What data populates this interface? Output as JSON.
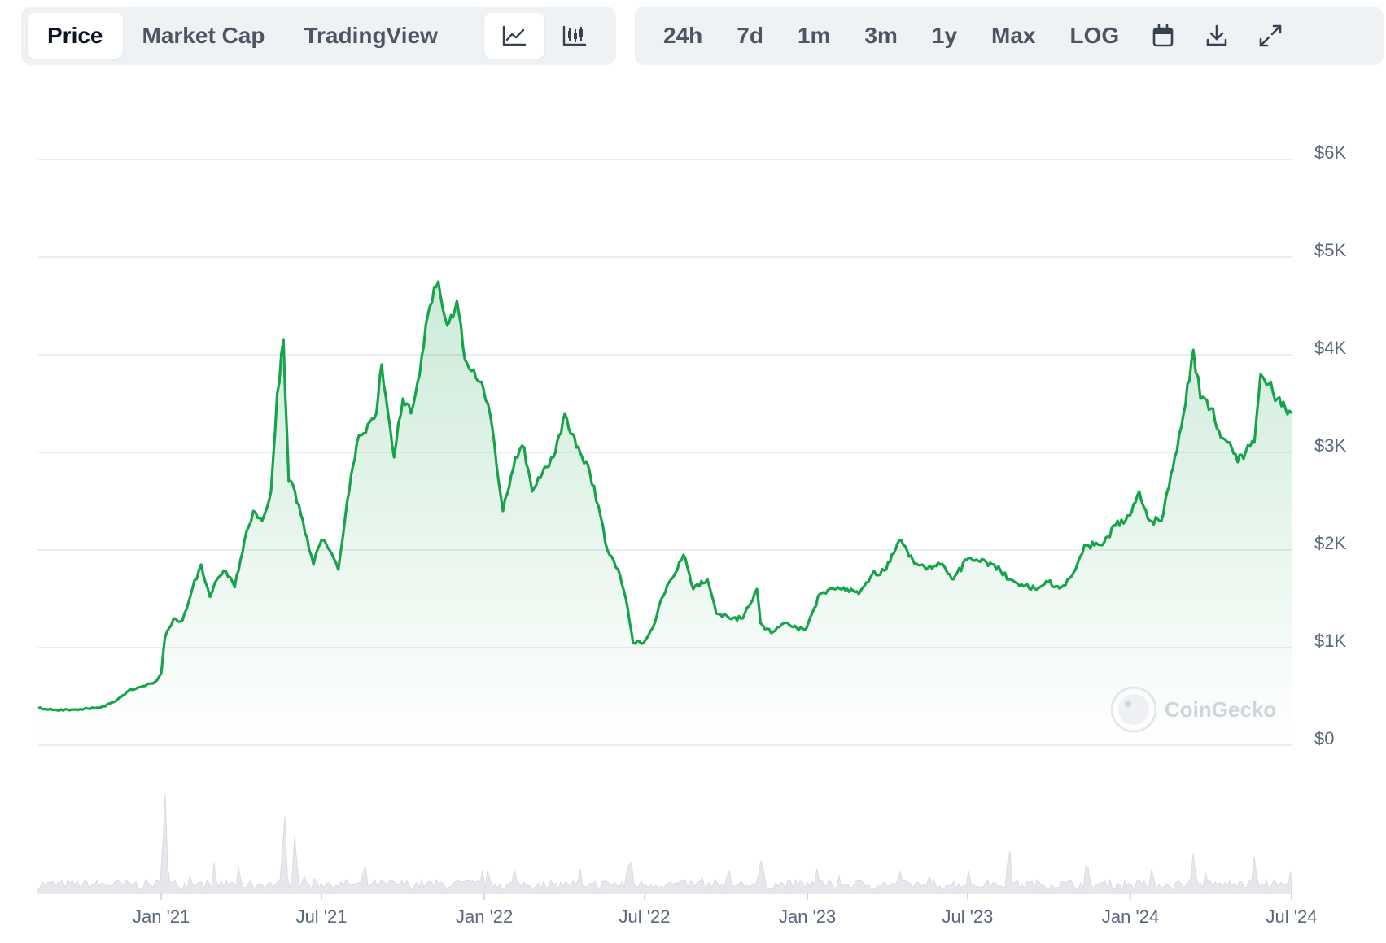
{
  "toolbar": {
    "chart_tabs": [
      {
        "label": "Price",
        "active": true
      },
      {
        "label": "Market Cap",
        "active": false
      },
      {
        "label": "TradingView",
        "active": false
      }
    ],
    "chart_style_icons": [
      "line-chart-icon",
      "candlestick-chart-icon"
    ],
    "ranges": [
      "24h",
      "7d",
      "1m",
      "3m",
      "1y",
      "Max",
      "LOG"
    ],
    "action_icons": [
      "calendar-icon",
      "download-icon",
      "fullscreen-icon"
    ]
  },
  "watermark": {
    "brand": "CoinGecko"
  },
  "colors": {
    "line": "#16a34a",
    "fill_top": "#16a34a",
    "grid": "#e5e7eb",
    "volume": "#e5e7eb",
    "toolbar_bg": "#eff2f5"
  },
  "chart_data": {
    "type": "area",
    "ylim": [
      0,
      6000
    ],
    "y_ticks": [
      {
        "value": 0,
        "label": "$0"
      },
      {
        "value": 1000,
        "label": "$1K"
      },
      {
        "value": 2000,
        "label": "$2K"
      },
      {
        "value": 3000,
        "label": "$3K"
      },
      {
        "value": 4000,
        "label": "$4K"
      },
      {
        "value": 5000,
        "label": "$5K"
      },
      {
        "value": 6000,
        "label": "$6K"
      }
    ],
    "x_range": [
      "2020-08-15",
      "2024-07-01"
    ],
    "x_ticks": [
      {
        "date": "2021-01-01",
        "label": "Jan '21"
      },
      {
        "date": "2021-07-01",
        "label": "Jul '21"
      },
      {
        "date": "2022-01-01",
        "label": "Jan '22"
      },
      {
        "date": "2022-07-01",
        "label": "Jul '22"
      },
      {
        "date": "2023-01-01",
        "label": "Jan '23"
      },
      {
        "date": "2023-07-01",
        "label": "Jul '23"
      },
      {
        "date": "2024-01-01",
        "label": "Jan '24"
      },
      {
        "date": "2024-07-01",
        "label": "Jul '24"
      }
    ],
    "grid": true,
    "series": [
      {
        "x": [
          "2020-08-15",
          "2020-09-05",
          "2020-10-01",
          "2020-10-25",
          "2020-11-10",
          "2020-11-25",
          "2020-12-10",
          "2020-12-25",
          "2021-01-01",
          "2021-01-05",
          "2021-01-15",
          "2021-01-25",
          "2021-02-05",
          "2021-02-15",
          "2021-02-25",
          "2021-03-05",
          "2021-03-15",
          "2021-03-25",
          "2021-04-05",
          "2021-04-15",
          "2021-04-25",
          "2021-05-05",
          "2021-05-12",
          "2021-05-19",
          "2021-05-25",
          "2021-06-01",
          "2021-06-10",
          "2021-06-22",
          "2021-07-01",
          "2021-07-10",
          "2021-07-20",
          "2021-07-30",
          "2021-08-10",
          "2021-08-20",
          "2021-09-01",
          "2021-09-07",
          "2021-09-21",
          "2021-10-01",
          "2021-10-10",
          "2021-10-20",
          "2021-10-29",
          "2021-11-10",
          "2021-11-20",
          "2021-12-01",
          "2021-12-10",
          "2021-12-20",
          "2021-12-31",
          "2022-01-10",
          "2022-01-22",
          "2022-02-05",
          "2022-02-15",
          "2022-02-24",
          "2022-03-10",
          "2022-03-20",
          "2022-04-02",
          "2022-04-15",
          "2022-04-30",
          "2022-05-10",
          "2022-05-20",
          "2022-06-01",
          "2022-06-12",
          "2022-06-18",
          "2022-06-30",
          "2022-07-10",
          "2022-07-20",
          "2022-07-31",
          "2022-08-14",
          "2022-08-25",
          "2022-09-10",
          "2022-09-20",
          "2022-10-05",
          "2022-10-20",
          "2022-11-05",
          "2022-11-09",
          "2022-11-21",
          "2022-12-05",
          "2022-12-20",
          "2022-12-31",
          "2023-01-15",
          "2023-01-31",
          "2023-02-15",
          "2023-02-28",
          "2023-03-15",
          "2023-03-31",
          "2023-04-15",
          "2023-04-30",
          "2023-05-15",
          "2023-05-31",
          "2023-06-15",
          "2023-06-30",
          "2023-07-15",
          "2023-07-31",
          "2023-08-17",
          "2023-08-31",
          "2023-09-15",
          "2023-09-30",
          "2023-10-15",
          "2023-10-31",
          "2023-11-10",
          "2023-11-30",
          "2023-12-15",
          "2023-12-31",
          "2024-01-11",
          "2024-01-23",
          "2024-02-05",
          "2024-02-20",
          "2024-03-01",
          "2024-03-12",
          "2024-03-20",
          "2024-04-01",
          "2024-04-12",
          "2024-04-20",
          "2024-05-01",
          "2024-05-10",
          "2024-05-20",
          "2024-05-27",
          "2024-06-05",
          "2024-06-15",
          "2024-06-24",
          "2024-07-01"
        ],
        "y": [
          380,
          360,
          370,
          390,
          450,
          560,
          600,
          650,
          740,
          1100,
          1300,
          1280,
          1600,
          1850,
          1520,
          1700,
          1780,
          1620,
          2100,
          2400,
          2300,
          2600,
          3600,
          4150,
          2700,
          2600,
          2300,
          1850,
          2100,
          2000,
          1800,
          2500,
          3100,
          3200,
          3400,
          3900,
          2950,
          3550,
          3400,
          3800,
          4400,
          4750,
          4300,
          4550,
          3950,
          3850,
          3650,
          3250,
          2400,
          2950,
          3050,
          2600,
          2850,
          2950,
          3400,
          3050,
          2800,
          2450,
          2000,
          1800,
          1400,
          1050,
          1050,
          1200,
          1500,
          1700,
          1950,
          1600,
          1700,
          1350,
          1300,
          1300,
          1600,
          1250,
          1150,
          1250,
          1200,
          1200,
          1550,
          1600,
          1600,
          1550,
          1750,
          1800,
          2100,
          1900,
          1800,
          1850,
          1700,
          1900,
          1880,
          1850,
          1700,
          1650,
          1600,
          1670,
          1620,
          1800,
          2050,
          2050,
          2250,
          2350,
          2600,
          2300,
          2300,
          2950,
          3400,
          4050,
          3550,
          3450,
          3150,
          3100,
          2900,
          3000,
          3100,
          3800,
          3700,
          3550,
          3450,
          3400
        ]
      }
    ],
    "volume_shape": "low-baseline with spikes near Jan '21, Jun '21 and Mar '24"
  }
}
